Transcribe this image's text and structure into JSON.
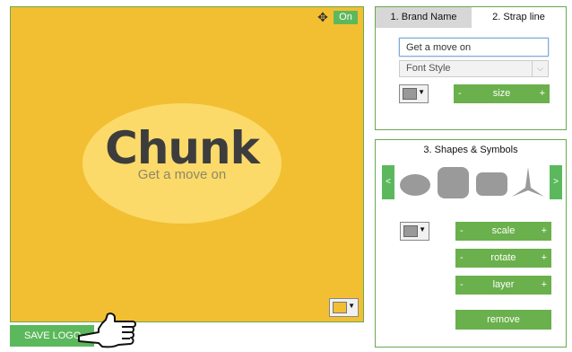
{
  "canvas": {
    "background_color": "#f2bf33",
    "move_icon": "move-arrows-icon",
    "toggle_label": "On",
    "logo": {
      "title": "Chunk",
      "subtitle": "Get a move on",
      "ellipse_color": "#fbda6a"
    },
    "color_picker_value": "#f2bf33"
  },
  "save_button": {
    "label": "SAVE LOGO"
  },
  "text_panel": {
    "tabs": [
      {
        "label": "1. Brand Name",
        "active": false
      },
      {
        "label": "2. Strap line",
        "active": true
      }
    ],
    "text_value": "Get a move on",
    "font_select": {
      "selected": "Font Style"
    },
    "color_value": "#999999",
    "size_stepper": {
      "label": "size",
      "minus": "-",
      "plus": "+"
    }
  },
  "shapes_panel": {
    "title": "3. Shapes & Symbols",
    "prev_label": "<",
    "next_label": ">",
    "shapes": [
      "ellipse",
      "rounded-square",
      "rounded-rectangle",
      "three-point-star"
    ],
    "color_value": "#999999",
    "scale_stepper": {
      "label": "scale",
      "minus": "-",
      "plus": "+"
    },
    "rotate_stepper": {
      "label": "rotate",
      "minus": "-",
      "plus": "+"
    },
    "layer_stepper": {
      "label": "layer",
      "minus": "-",
      "plus": "+"
    },
    "remove_label": "remove"
  },
  "colors": {
    "accent_green": "#5cb85c",
    "border_green": "#6aa84f"
  }
}
